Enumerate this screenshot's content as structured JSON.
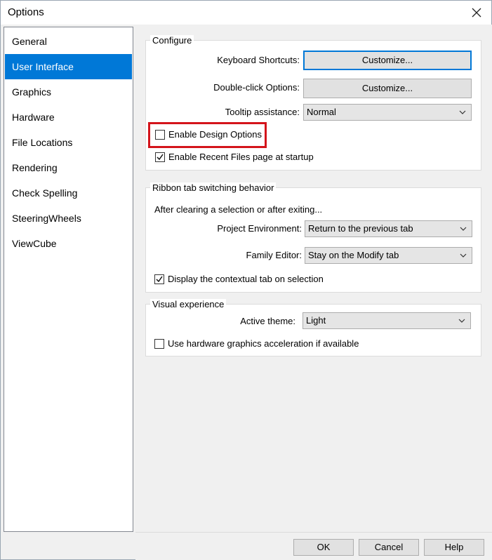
{
  "window": {
    "title": "Options",
    "close_icon": "close-icon"
  },
  "nav": {
    "items": [
      {
        "label": "General"
      },
      {
        "label": "User Interface",
        "selected": true
      },
      {
        "label": "Graphics"
      },
      {
        "label": "Hardware"
      },
      {
        "label": "File Locations"
      },
      {
        "label": "Rendering"
      },
      {
        "label": "Check Spelling"
      },
      {
        "label": "SteeringWheels"
      },
      {
        "label": "ViewCube"
      }
    ]
  },
  "configure": {
    "title": "Configure",
    "keyboard_shortcuts_label": "Keyboard Shortcuts:",
    "keyboard_shortcuts_button": "Customize...",
    "double_click_label": "Double-click Options:",
    "double_click_button": "Customize...",
    "tooltip_label": "Tooltip assistance:",
    "tooltip_value": "Normal",
    "enable_design_options": {
      "label": "Enable Design Options",
      "checked": false
    },
    "enable_recent_files": {
      "label": "Enable Recent Files page at startup",
      "checked": true
    }
  },
  "ribbon": {
    "title": "Ribbon tab switching behavior",
    "subtitle": "After clearing a selection or after exiting...",
    "project_env_label": "Project Environment:",
    "project_env_value": "Return to the previous tab",
    "family_editor_label": "Family Editor:",
    "family_editor_value": "Stay on the Modify tab",
    "display_contextual": {
      "label": "Display the contextual tab on selection",
      "checked": true
    }
  },
  "visual": {
    "title": "Visual experience",
    "active_theme_label": "Active theme:",
    "active_theme_value": "Light",
    "hw_accel": {
      "label": "Use hardware graphics acceleration if available",
      "checked": false
    }
  },
  "footer": {
    "ok": "OK",
    "cancel": "Cancel",
    "help": "Help"
  },
  "colors": {
    "selected_nav": "#0078d7",
    "highlight": "#d4141b"
  }
}
